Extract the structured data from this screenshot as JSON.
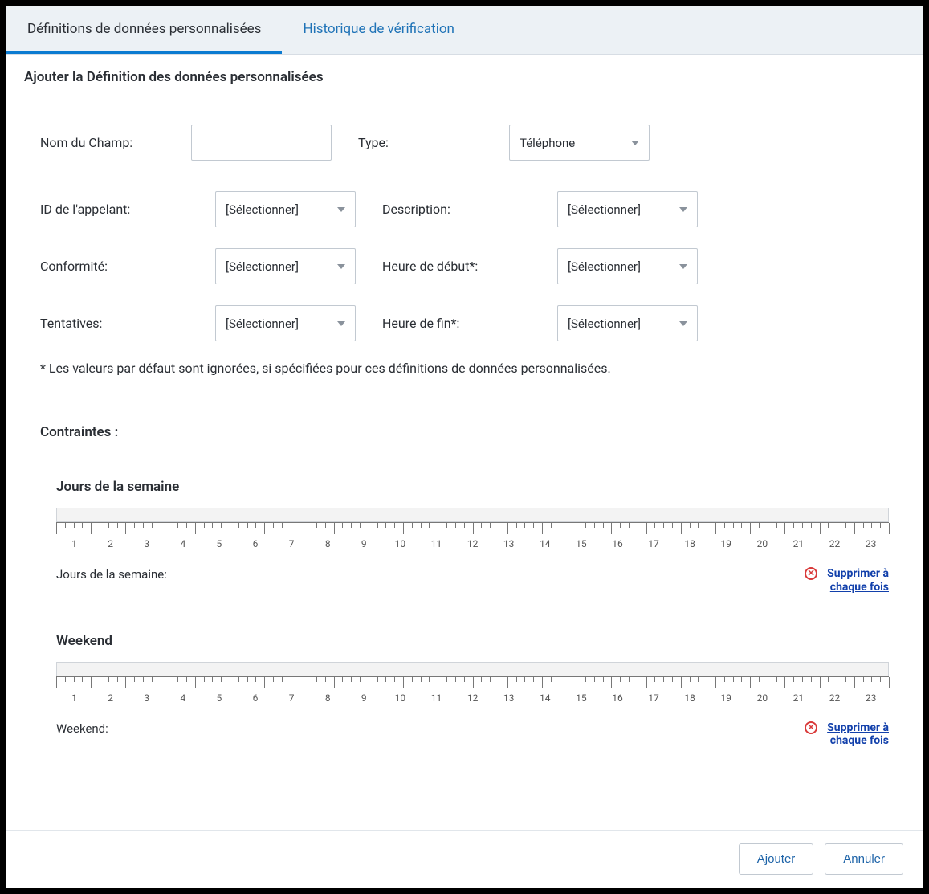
{
  "tabs": {
    "defs": "Définitions de données personnalisées",
    "hist": "Historique de vérification"
  },
  "header": {
    "title": "Ajouter la Définition des données personnalisées"
  },
  "form": {
    "field_name_label": "Nom du Champ:",
    "field_name_value": "",
    "type_label": "Type:",
    "type_value": "Téléphone",
    "caller_id_label": "ID de l'appelant:",
    "caller_id_value": "[Sélectionner]",
    "description_label": "Description:",
    "description_value": "[Sélectionner]",
    "compliance_label": "Conformité:",
    "compliance_value": "[Sélectionner]",
    "start_time_label": "Heure de début*:",
    "start_time_value": "[Sélectionner]",
    "attempts_label": "Tentatives:",
    "attempts_value": "[Sélectionner]",
    "end_time_label": "Heure de fin*:",
    "end_time_value": "[Sélectionner]",
    "footnote": "* Les valeurs par défaut sont ignorées, si spécifiées pour ces définitions de données personnalisées."
  },
  "constraints": {
    "title": "Contraintes :",
    "weekdays": {
      "heading": "Jours de la semaine",
      "foot_label": "Jours de la semaine:",
      "delete_link": "Supprimer à chaque fois",
      "hours": [
        "1",
        "2",
        "3",
        "4",
        "5",
        "6",
        "7",
        "8",
        "9",
        "10",
        "11",
        "12",
        "13",
        "14",
        "15",
        "16",
        "17",
        "18",
        "19",
        "20",
        "21",
        "22",
        "23"
      ]
    },
    "weekend": {
      "heading": "Weekend",
      "foot_label": "Weekend:",
      "delete_link": "Supprimer à chaque fois",
      "hours": [
        "1",
        "2",
        "3",
        "4",
        "5",
        "6",
        "7",
        "8",
        "9",
        "10",
        "11",
        "12",
        "13",
        "14",
        "15",
        "16",
        "17",
        "18",
        "19",
        "20",
        "21",
        "22",
        "23"
      ]
    }
  },
  "footer": {
    "add": "Ajouter",
    "cancel": "Annuler"
  }
}
